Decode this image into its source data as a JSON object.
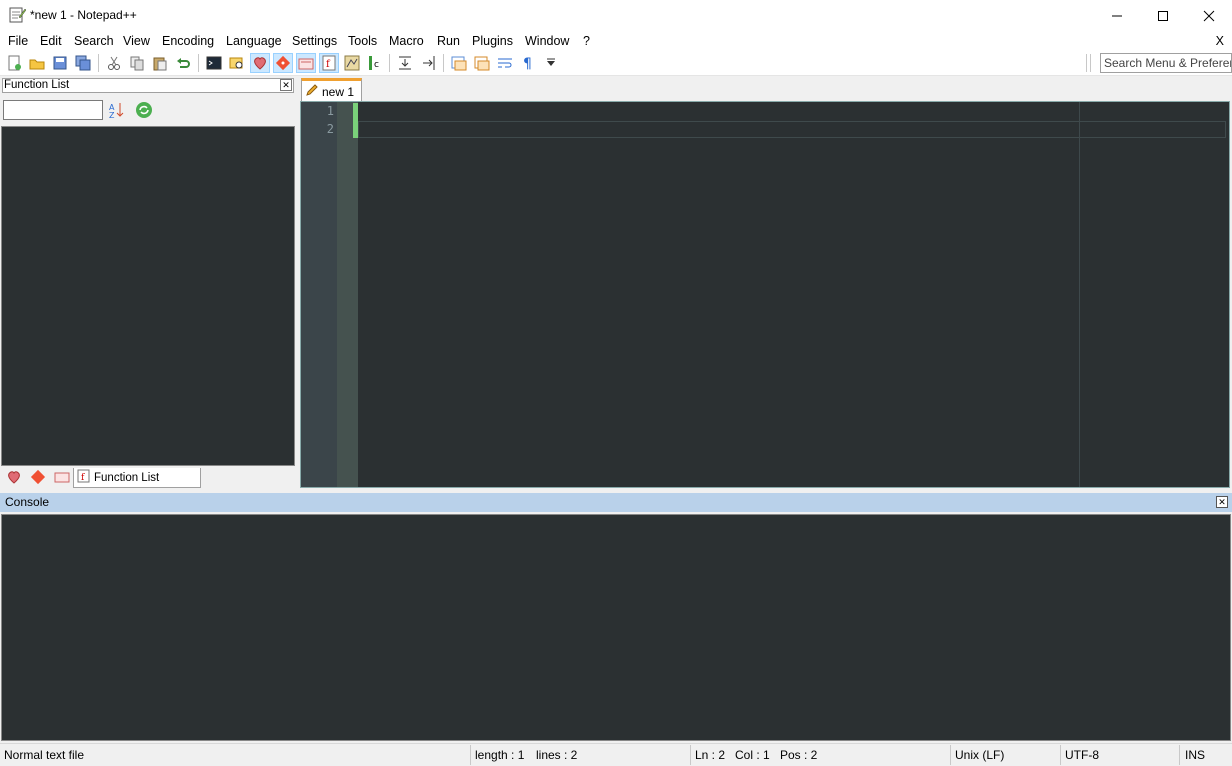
{
  "window": {
    "title": "*new 1 - Notepad++"
  },
  "menu": [
    {
      "label": "File"
    },
    {
      "label": "Edit"
    },
    {
      "label": "Search"
    },
    {
      "label": "View"
    },
    {
      "label": "Encoding"
    },
    {
      "label": "Language"
    },
    {
      "label": "Settings"
    },
    {
      "label": "Tools"
    },
    {
      "label": "Macro"
    },
    {
      "label": "Run"
    },
    {
      "label": "Plugins"
    },
    {
      "label": "Window"
    },
    {
      "label": "?"
    }
  ],
  "menu_close": "X",
  "toolbar": {
    "search_placeholder": "Search Menu & Preferences",
    "icons": [
      "new-file-icon",
      "open-file-icon",
      "save-icon",
      "save-all-icon",
      "close-icon",
      "cut-icon",
      "copy-icon",
      "paste-icon",
      "undo-icon",
      "terminal-icon",
      "find-icon",
      "bookmark-icon",
      "git-icon",
      "folder-icon",
      "function-list-icon",
      "doc-map-icon",
      "column-icon",
      "indent-icon",
      "outdent-icon",
      "sync-scroll-icon",
      "clone-icon",
      "wrap-icon",
      "pilcrow-icon",
      "dropdown-icon"
    ]
  },
  "function_list": {
    "title": "Function List",
    "tab_label": "Function List"
  },
  "editor": {
    "tab_label": "new 1",
    "line_numbers": [
      "1",
      "2"
    ]
  },
  "console": {
    "title": "Console"
  },
  "status": {
    "file_type": "Normal text file",
    "length": "length : 1",
    "lines": "lines : 2",
    "ln": "Ln : 2",
    "col": "Col : 1",
    "pos": "Pos : 2",
    "eol": "Unix (LF)",
    "encoding": "UTF-8",
    "mode": "INS"
  },
  "colors": {
    "editor_bg": "#2b3032",
    "accent_tab": "#f0a030",
    "change_bar": "#7ad17a"
  }
}
